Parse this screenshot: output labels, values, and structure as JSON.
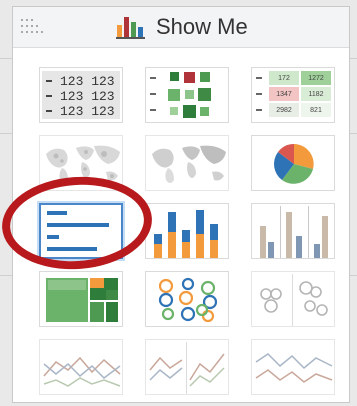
{
  "title": "Show Me",
  "colors": {
    "selection_blue": "#4a86c8",
    "bar_blue": "#2e73b5",
    "bar_orange": "#f39b3c",
    "annotation_red": "#b8191c",
    "heat_green": "#4f9a52",
    "heat_red": "#b0333a"
  },
  "thumbnails": [
    {
      "name": "text-table",
      "selected": false,
      "enabled": true,
      "rows": [
        "123  123",
        "123  123",
        "123  123"
      ]
    },
    {
      "name": "heat-map",
      "selected": false,
      "enabled": true
    },
    {
      "name": "highlight-table",
      "selected": false,
      "enabled": true,
      "cells": [
        [
          "172",
          "1272"
        ],
        [
          "1347",
          "1182"
        ],
        [
          "2982",
          "821"
        ]
      ]
    },
    {
      "name": "symbol-map",
      "selected": false,
      "enabled": false
    },
    {
      "name": "filled-map",
      "selected": false,
      "enabled": false
    },
    {
      "name": "pie-chart",
      "selected": false,
      "enabled": true
    },
    {
      "name": "horizontal-bars",
      "selected": true,
      "enabled": true
    },
    {
      "name": "stacked-bars",
      "selected": false,
      "enabled": true
    },
    {
      "name": "side-by-side-bars",
      "selected": false,
      "enabled": true
    },
    {
      "name": "treemap",
      "selected": false,
      "enabled": true
    },
    {
      "name": "circle-views",
      "selected": false,
      "enabled": true
    },
    {
      "name": "side-by-side-circles",
      "selected": false,
      "enabled": false
    },
    {
      "name": "lines-continuous",
      "selected": false,
      "enabled": false
    },
    {
      "name": "lines-discrete",
      "selected": false,
      "enabled": false
    },
    {
      "name": "dual-lines",
      "selected": false,
      "enabled": false
    }
  ]
}
